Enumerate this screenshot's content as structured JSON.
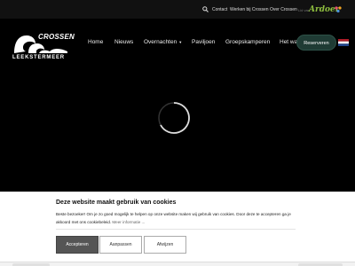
{
  "topbar": {
    "links": [
      "Contact",
      "Werken bij Crossen",
      "Over Crossen"
    ],
    "partner_prefix": "Lid van",
    "partner_brand": "Ardoer"
  },
  "logo": {
    "top_word": "CROSSEN",
    "bottom_word": "LEEKSTERMEER"
  },
  "nav": {
    "items": [
      "Home",
      "Nieuws",
      "Overnachten",
      "Paviljoen",
      "Groepskamperen",
      "Het wa"
    ],
    "reserve_label": "Reserveren"
  },
  "cookie": {
    "title": "Deze website maakt gebruik van cookies",
    "text": "Beste bezoeker! Om je zo goed mogelijk te helpen op onze website maken wij gebruik van cookies. Door deze te accepteren ga je akkoord met ons cookiebeleid.",
    "more": "Meer informatie ...",
    "accept": "Accepteren",
    "customize": "Aanpassen",
    "decline": "Afwijzen"
  },
  "colors": {
    "reserve_bg": "#1f3b34",
    "ardoer_green": "#8fbf3f",
    "accept_bg": "#555555"
  }
}
